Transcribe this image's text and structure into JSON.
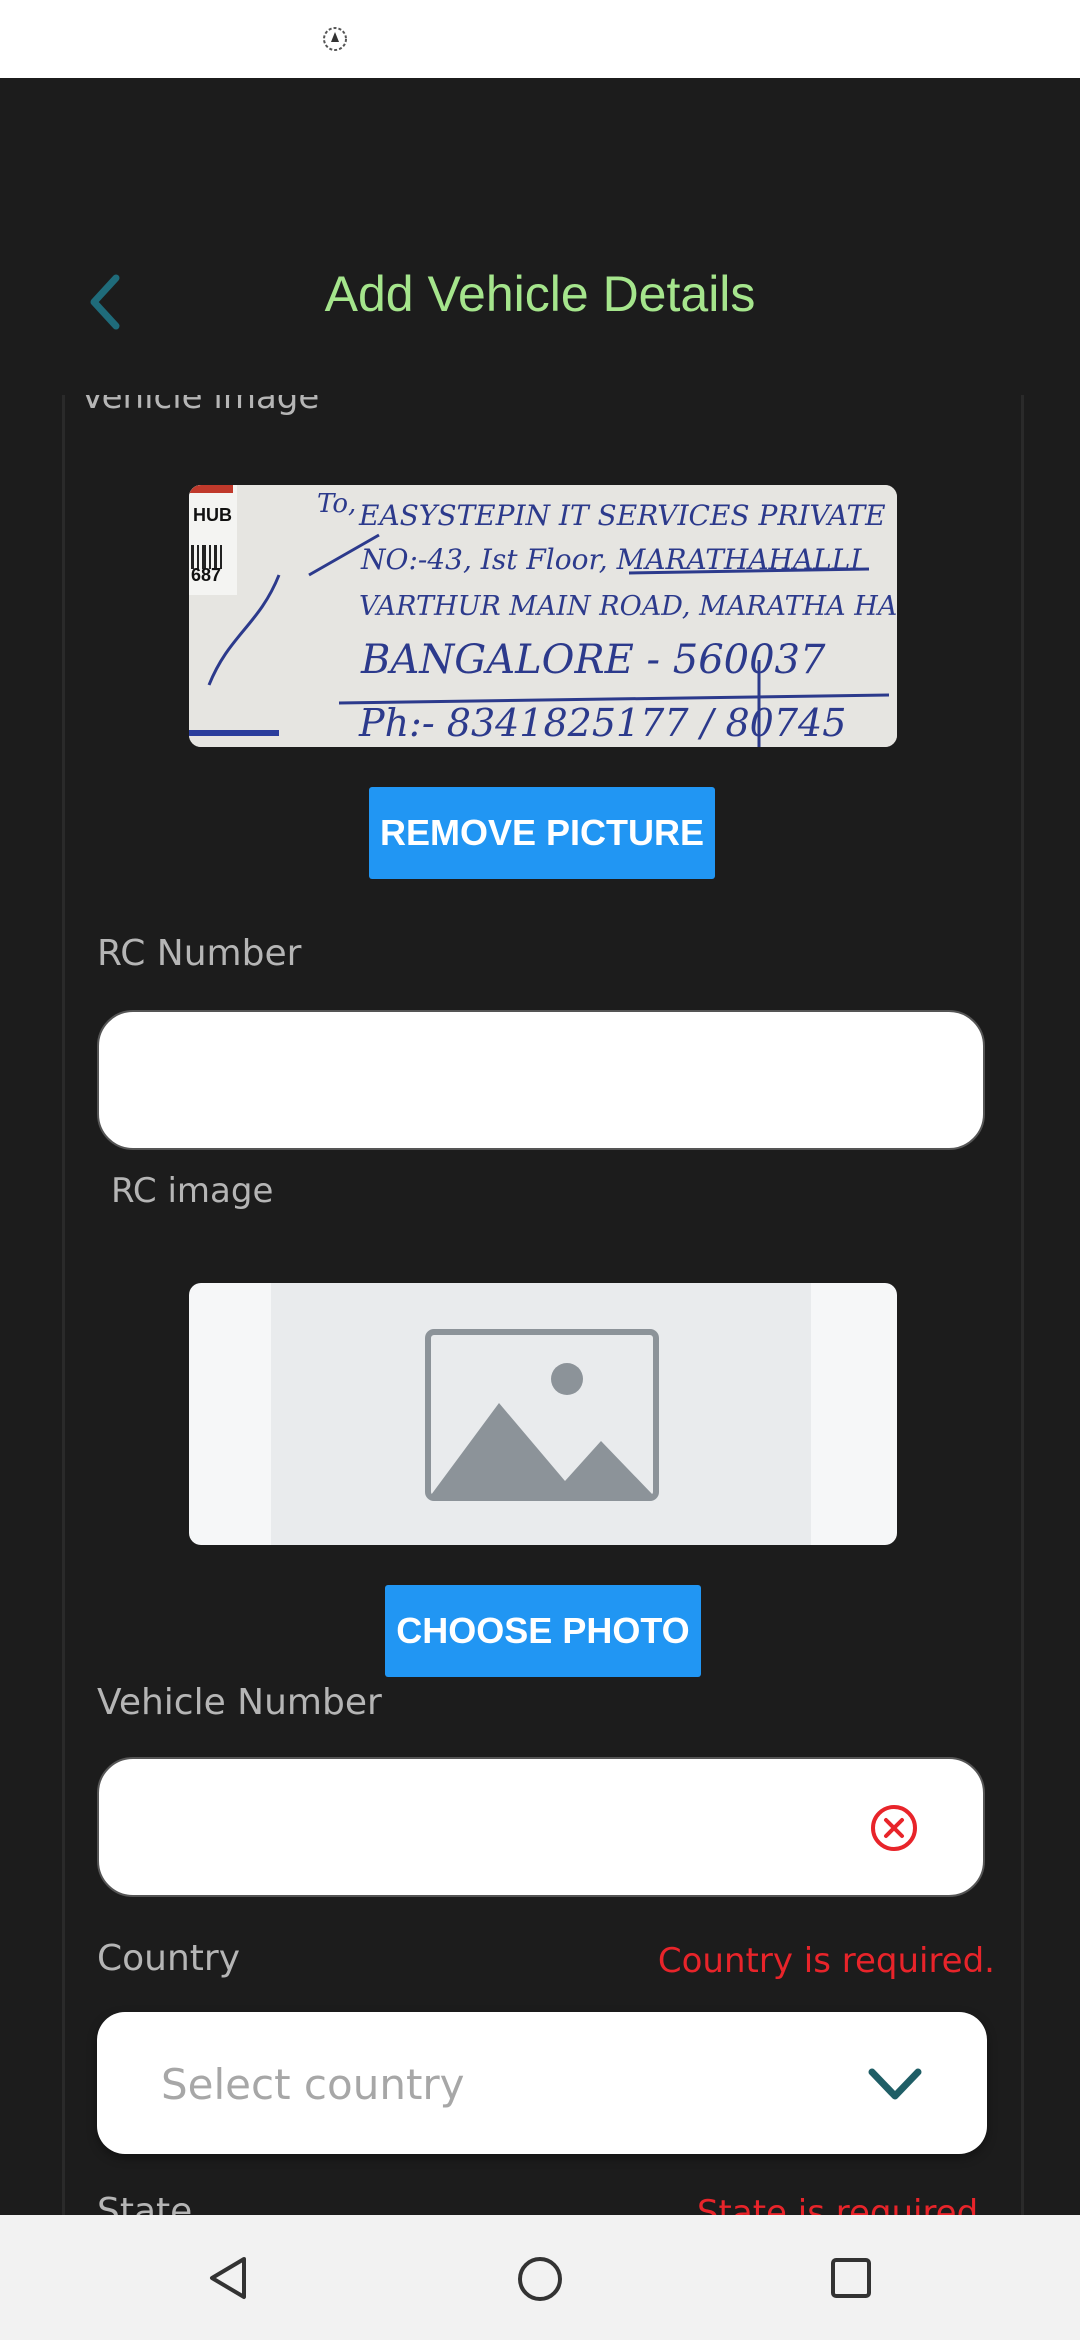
{
  "header": {
    "title": "Add Vehicle Details"
  },
  "vehicle_image": {
    "label": "Vehicle image",
    "remove_label": "REMOVE PICTURE"
  },
  "rc_number": {
    "label": "RC Number",
    "value": ""
  },
  "rc_image": {
    "label": "RC image",
    "choose_label": "CHOOSE PHOTO"
  },
  "vehicle_number": {
    "label": "Vehicle Number",
    "value": ""
  },
  "country": {
    "label": "Country",
    "error": "Country is required.",
    "placeholder": "Select country"
  },
  "state": {
    "label": "State",
    "error": "State is required."
  },
  "colors": {
    "accent": "#2196f3",
    "title": "#a5e58c",
    "error": "#e8242a",
    "back": "#1f6b7a"
  },
  "photo_text": {
    "line1": "EASYSTEPIN IT SERVICES PRIVATE",
    "line2": "NO:-43, Ist Floor, MARATHAHALLI",
    "line3": "VARTHUR MAIN ROAD, MARATHA HA",
    "line4": "BANGALORE - 560037",
    "line5": "Ph:- 8341825177 / 80745",
    "to": "To,",
    "hub": "HUB",
    "code": "687"
  },
  "icons": [
    "back-chevron-icon",
    "image-placeholder-icon",
    "clear-error-icon",
    "chevron-down-icon",
    "nav-back-icon",
    "nav-home-icon",
    "nav-recents-icon"
  ]
}
